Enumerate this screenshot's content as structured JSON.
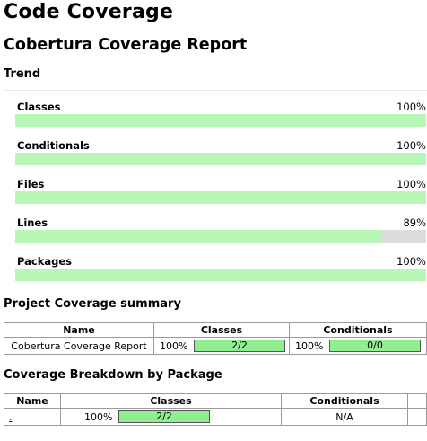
{
  "page_title": "Code Coverage",
  "report_title": "Cobertura Coverage Report",
  "trend": {
    "heading": "Trend",
    "rows": [
      {
        "name": "Classes",
        "percent_label": "100%",
        "value": 1.0
      },
      {
        "name": "Conditionals",
        "percent_label": "100%",
        "value": 1.0
      },
      {
        "name": "Files",
        "percent_label": "100%",
        "value": 1.0
      },
      {
        "name": "Lines",
        "percent_label": "89%",
        "value": 0.89
      },
      {
        "name": "Packages",
        "percent_label": "100%",
        "value": 1.0
      }
    ]
  },
  "summary": {
    "heading": "Project Coverage summary",
    "headers": [
      "Name",
      "Classes",
      "Conditionals"
    ],
    "row": {
      "name": "Cobertura Coverage Report",
      "classes_pct": "100%",
      "classes_ratio": "2/2",
      "conditionals_pct": "100%",
      "conditionals_ratio": "0/0"
    }
  },
  "breakdown": {
    "heading": "Coverage Breakdown by Package",
    "headers": [
      "Name",
      "Classes",
      "Conditionals"
    ],
    "row": {
      "name": ".",
      "classes_pct": "100%",
      "classes_ratio": "2/2",
      "conditionals": "N/A"
    }
  },
  "colors": {
    "trend_fill": "#b8f7b8",
    "trend_track": "#dcdcdc",
    "table_bar": "#90ee90"
  }
}
